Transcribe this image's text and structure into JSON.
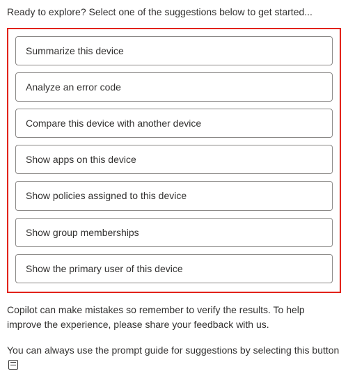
{
  "intro": "Ready to explore? Select one of the suggestions below to get started...",
  "suggestions": [
    {
      "label": "Summarize this device"
    },
    {
      "label": "Analyze an error code"
    },
    {
      "label": "Compare this device with another device"
    },
    {
      "label": "Show apps on this device"
    },
    {
      "label": "Show policies assigned to this device"
    },
    {
      "label": "Show group memberships"
    },
    {
      "label": "Show the primary user of this device"
    }
  ],
  "disclaimer": "Copilot can make mistakes so remember to verify the results. To help improve the experience, please share your feedback with us.",
  "hint_prefix": "You can always use the prompt guide for suggestions by selecting this button "
}
